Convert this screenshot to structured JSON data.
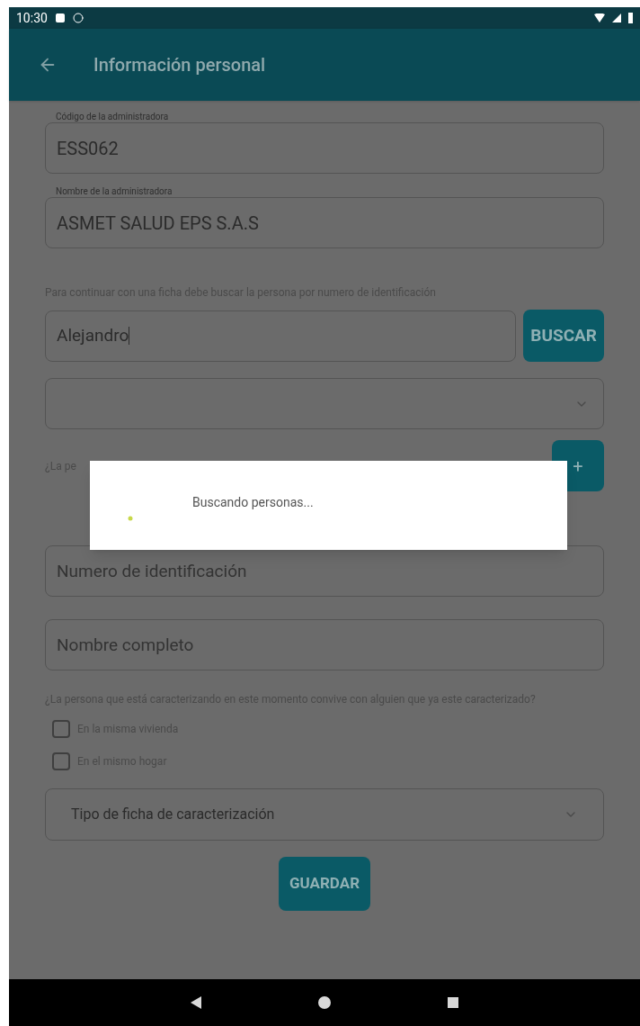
{
  "status_bar": {
    "time": "10:30"
  },
  "app_bar": {
    "title": "Información personal"
  },
  "fields": [
    {
      "label": "Código de la administradora",
      "value": "ESS062"
    },
    {
      "label": "Nombre de la administradora",
      "value": "ASMET SALUD EPS S.A.S"
    }
  ],
  "search_hint": "Para continuar con una ficha debe buscar la persona por numero de identificación",
  "search": {
    "value": "Alejandro",
    "button": "BUSCAR"
  },
  "question_partial": "¿La pe",
  "add_button": "+",
  "person_fields": [
    {
      "placeholder": "Numero de identificación"
    },
    {
      "placeholder": "Nombre completo"
    }
  ],
  "cohabit_question": "¿La persona que está caracterizando en este momento convive con alguien que ya este caracterizado?",
  "checkboxes": [
    {
      "label": "En la misma vivienda",
      "checked": false
    },
    {
      "label": "En el mismo hogar",
      "checked": false
    }
  ],
  "type_select": {
    "value": "Tipo de ficha de caracterización"
  },
  "save_button": "GUARDAR",
  "dialog": {
    "message": "Buscando personas..."
  }
}
